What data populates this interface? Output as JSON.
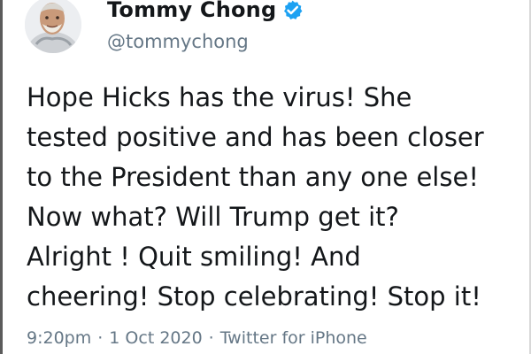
{
  "tweet": {
    "author": {
      "display_name": "Tommy Chong",
      "handle": "@tommychong",
      "avatar_icon": "avatar-portrait",
      "verified_icon": "verified-badge-icon",
      "verified_color": "#1da1f2"
    },
    "text": "Hope Hicks has the virus! She\ntested positive and has been closer\nto the President than any one else!\nNow what? Will Trump get it?\nAlright ! Quit smiling! And\ncheering! Stop celebrating! Stop it!",
    "time": "9:20pm",
    "separator_1": "·",
    "date": "1 Oct 2020",
    "separator_2": "·",
    "source": "Twitter for iPhone"
  },
  "colors": {
    "text_primary": "#14171a",
    "text_secondary": "#657786",
    "background": "#ffffff"
  }
}
